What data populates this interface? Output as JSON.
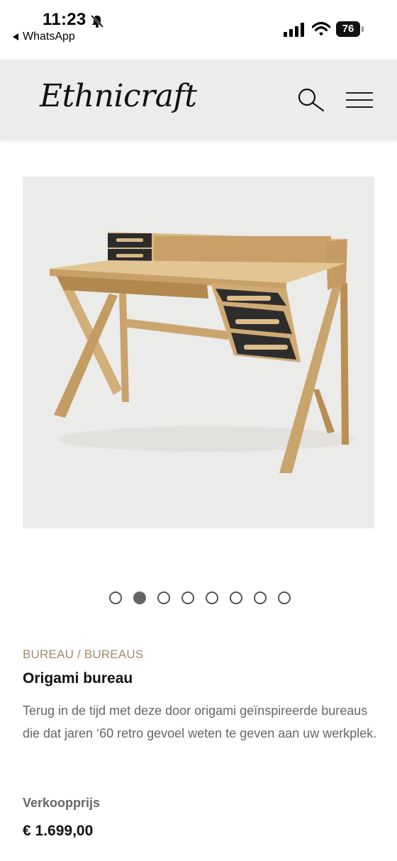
{
  "status_bar": {
    "time": "11:23",
    "back_app": "WhatsApp",
    "battery": "76",
    "icons": [
      "bell-muted-icon",
      "signal-icon",
      "wifi-icon",
      "battery-icon"
    ]
  },
  "header": {
    "logo": "Ethnicraft",
    "search_icon": "search-icon",
    "menu_icon": "hamburger-menu-icon"
  },
  "product": {
    "image_subject": "oak desk with black drawers",
    "carousel": {
      "total": 8,
      "active_index": 1
    },
    "category": "BUREAU / BUREAUS",
    "title": "Origami bureau",
    "description": "Terug in de tijd met deze door origami geïnspireerde bureaus die dat jaren ‘60 retro gevoel weten te geven aan uw werkplek.",
    "price_label": "Verkoopprijs",
    "price": "€ 1.699,00"
  },
  "colors": {
    "header_bg": "#ececec",
    "category": "#a08a6a",
    "body_text": "#666666",
    "image_bg": "#ebebea"
  }
}
